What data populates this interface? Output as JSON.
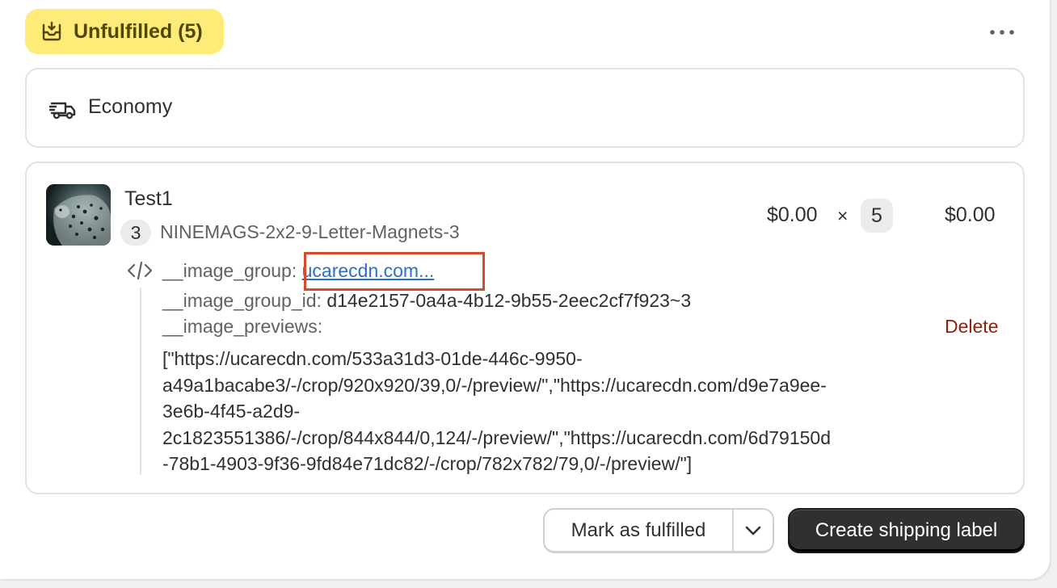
{
  "status_badge": {
    "label": "Unfulfilled (5)",
    "icon": "unfulfilled-box-icon",
    "color": "#ffeb78"
  },
  "more_actions": {
    "icon": "ellipsis-icon"
  },
  "delivery": {
    "method": "Economy",
    "icon": "truck-icon"
  },
  "line_item": {
    "title": "Test1",
    "quantity_badge": "3",
    "sku": "NINEMAGS-2x2-9-Letter-Magnets-3",
    "unit_price": "$0.00",
    "times": "×",
    "quantity": "5",
    "total": "$0.00",
    "properties": {
      "icon": "code-icon",
      "image_group_key": "__image_group:",
      "image_group_value": "ucarecdn.com...",
      "image_group_id_key": "__image_group_id:",
      "image_group_id_value": "d14e2157-0a4a-4b12-9b55-2eec2cf7f923~3",
      "image_previews_key": "__image_previews:",
      "image_previews_lines": [
        "[\"https://ucarecdn.com/533a31d3-01de-446c-9950-",
        "a49a1bacabe3/-/crop/920x920/39,0/-/preview/\",\"https://ucarecdn.com/d9e7a9ee-",
        "3e6b-4f45-a2d9-",
        "2c1823551386/-/crop/844x844/0,124/-/preview/\",\"https://ucarecdn.com/6d79150d",
        "-78b1-4903-9f36-9fd84e71dc82/-/crop/782x782/79,0/-/preview/\"]"
      ]
    },
    "delete_label": "Delete"
  },
  "actions": {
    "mark_fulfilled": "Mark as fulfilled",
    "menu_icon": "chevron-down-icon",
    "create_label": "Create shipping label"
  },
  "colors": {
    "accent_dark": "#303030",
    "link": "#2c6ecb",
    "danger": "#8e1f0b",
    "highlight_border": "#d84a2e"
  }
}
